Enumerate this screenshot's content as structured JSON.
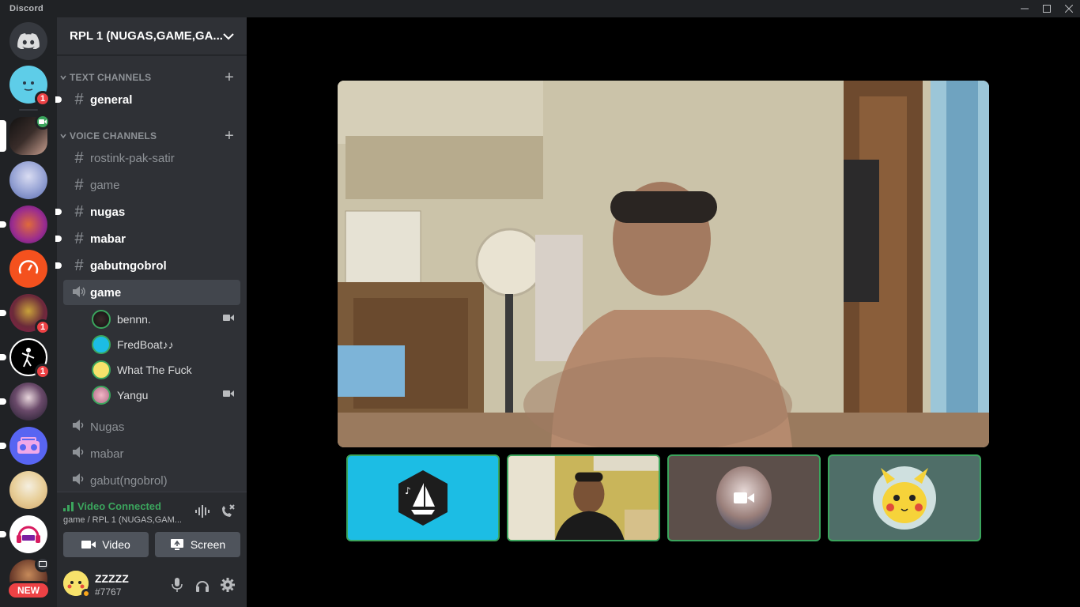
{
  "window": {
    "app_name": "Discord"
  },
  "servers": {
    "badges": [
      "1",
      "1",
      "1"
    ],
    "new_label": "NEW"
  },
  "guild": {
    "name": "RPL 1 (NUGAS,GAME,GA..."
  },
  "categories": {
    "text": "TEXT CHANNELS",
    "voice": "VOICE CHANNELS"
  },
  "text_channels": [
    {
      "name": "general"
    }
  ],
  "voice_area_channels": [
    {
      "name": "rostink-pak-satir"
    },
    {
      "name": "game"
    },
    {
      "name": "nugas"
    },
    {
      "name": "mabar"
    },
    {
      "name": "gabutngobrol"
    }
  ],
  "active_voice": {
    "name": "game"
  },
  "voice_users": [
    {
      "name": "bennn.",
      "video": true
    },
    {
      "name": "FredBoat♪♪",
      "video": false
    },
    {
      "name": "What The Fuck",
      "video": false
    },
    {
      "name": "Yangu",
      "video": true
    }
  ],
  "other_voice": [
    {
      "name": "Nugas"
    },
    {
      "name": "mabar"
    },
    {
      "name": "gabut(ngobrol)"
    }
  ],
  "rtc": {
    "status": "Video Connected",
    "subtext": "game / RPL 1 (NUGAS,GAM...",
    "video_label": "Video",
    "screen_label": "Screen"
  },
  "user": {
    "name": "ZZZZZ",
    "tag": "#7767"
  },
  "colors": {
    "green": "#3ba55d",
    "red": "#ed4245",
    "blurple": "#5865f2",
    "fredboat_bg": "#1cbde4"
  }
}
